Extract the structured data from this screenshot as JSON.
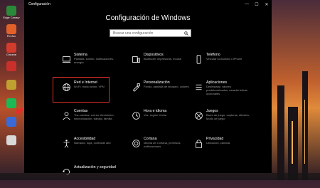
{
  "window": {
    "title": "Configuración",
    "heading": "Configuración de Windows",
    "minimize": "—",
    "maximize": "☐",
    "close": "✕"
  },
  "search": {
    "placeholder": "Buscar una configuración"
  },
  "desktop": {
    "icons": [
      {
        "label": "Edge Canary",
        "color": "#2a8a3a"
      },
      {
        "label": "Firefox",
        "color": "#e2602a"
      },
      {
        "label": "Chrome",
        "color": "#d33b2d"
      },
      {
        "label": "",
        "color": "#c9302c"
      },
      {
        "label": "",
        "color": "#c0a030"
      },
      {
        "label": "",
        "color": "#1db954"
      },
      {
        "label": "",
        "color": "#3a6ad8"
      },
      {
        "label": "",
        "color": "#d8d8d8"
      }
    ]
  },
  "tiles": [
    {
      "name": "Sistema",
      "desc": "Pantalla, sonido, notificaciones, energía",
      "icon": "laptop-icon"
    },
    {
      "name": "Dispositivos",
      "desc": "Bluetooth, impresoras, mouse",
      "icon": "devices-icon"
    },
    {
      "name": "Teléfono",
      "desc": "Vincular tu Android o iPhone",
      "icon": "phone-icon"
    },
    {
      "name": "Red e Internet",
      "desc": "Wi-Fi, modo avión, VPN",
      "icon": "globe-icon"
    },
    {
      "name": "Personalización",
      "desc": "Fondo, pantalla de bloqueo, colores",
      "icon": "brush-icon"
    },
    {
      "name": "Aplicaciones",
      "desc": "Desinstalar, valores predeterminados, características opcionales",
      "icon": "apps-icon"
    },
    {
      "name": "Cuentas",
      "desc": "Tus cuentas, correo electrónico, sincronización, trabajo, familia",
      "icon": "person-icon"
    },
    {
      "name": "Hora e idioma",
      "desc": "Voz, región, fecha",
      "icon": "clock-icon"
    },
    {
      "name": "Juegos",
      "desc": "Barra de juego, capturas, difusión, Modo de juego",
      "icon": "xbox-icon"
    },
    {
      "name": "Accesibilidad",
      "desc": "Narrador, lupa, contraste alto",
      "icon": "accessibility-icon"
    },
    {
      "name": "Cortana",
      "desc": "Idioma de Cortana, permisos, notificaciones",
      "icon": "cortana-icon"
    },
    {
      "name": "Privacidad",
      "desc": "Ubicación, cámara",
      "icon": "lock-icon"
    },
    {
      "name": "Actualización y seguridad",
      "desc": "",
      "icon": "update-icon"
    }
  ],
  "selected_tile": "Red e Internet",
  "colors": {
    "accent": "#e0302a",
    "window_bg": "#000000",
    "text": "#ffffff",
    "muted": "#9a9a9a"
  }
}
